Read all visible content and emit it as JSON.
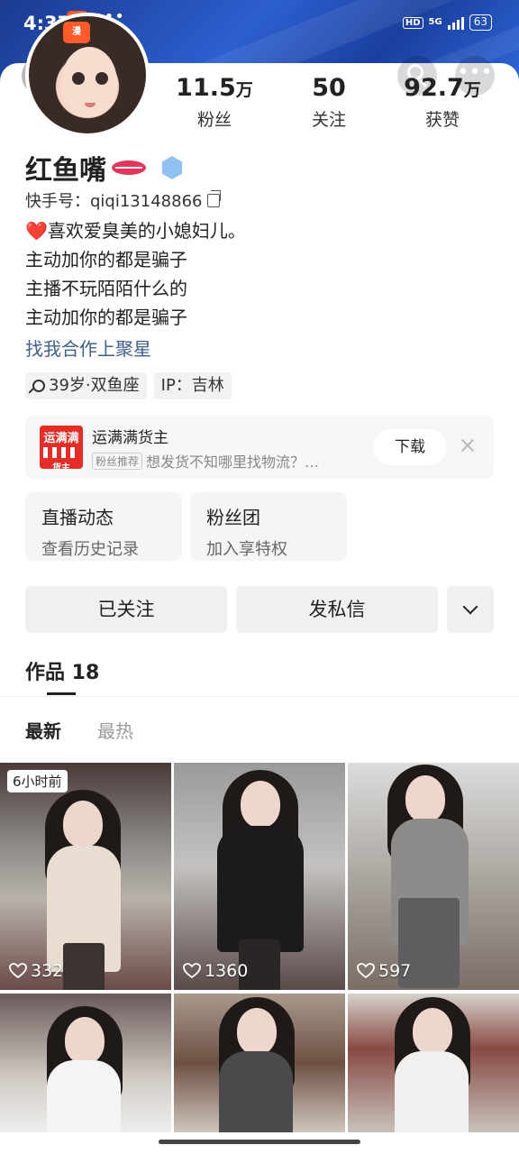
{
  "status_bar": {
    "time": "4:37",
    "app_badge": "漫",
    "dots": "•••",
    "hd": "HD",
    "network": "5G",
    "battery": "63"
  },
  "header": {
    "back_label": "‹",
    "more_label": "•••",
    "avatar_badge": "漫"
  },
  "stats": {
    "fans": {
      "value": "11.5",
      "unit": "万",
      "label": "粉丝"
    },
    "following": {
      "value": "50",
      "unit": "",
      "label": "关注"
    },
    "likes": {
      "value": "92.7",
      "unit": "万",
      "label": "获赞"
    }
  },
  "profile": {
    "nickname": "红鱼嘴",
    "account_id": "快手号：qiqi13148866",
    "bio_heart": "❤️",
    "bio_lines": [
      "喜欢爱臭美的小媳妇儿。",
      "主动加你的都是骗子",
      "主播不玩陌陌什么的",
      "主动加你的都是骗子"
    ],
    "collab_link": "找我合作上聚星",
    "tags": [
      "39岁·双鱼座",
      "IP：吉林"
    ]
  },
  "ad": {
    "logo_top": "运满满",
    "logo_bottom": "货主",
    "title": "运满满货主",
    "tag": "粉丝推荐",
    "subtitle": "想发货不知哪里找物流？…",
    "download_label": "下载"
  },
  "entries": [
    {
      "title": "直播动态",
      "subtitle": "查看历史记录"
    },
    {
      "title": "粉丝团",
      "subtitle": "加入享特权"
    }
  ],
  "actions": {
    "followed_label": "已关注",
    "message_label": "发私信"
  },
  "works": {
    "tab_label": "作品 18",
    "sort_newest": "最新",
    "sort_hottest": "最热",
    "items": [
      {
        "likes": "332",
        "time_badge": "6小时前"
      },
      {
        "likes": "1360"
      },
      {
        "likes": "597"
      },
      {
        "likes": ""
      },
      {
        "likes": ""
      },
      {
        "likes": ""
      }
    ]
  }
}
